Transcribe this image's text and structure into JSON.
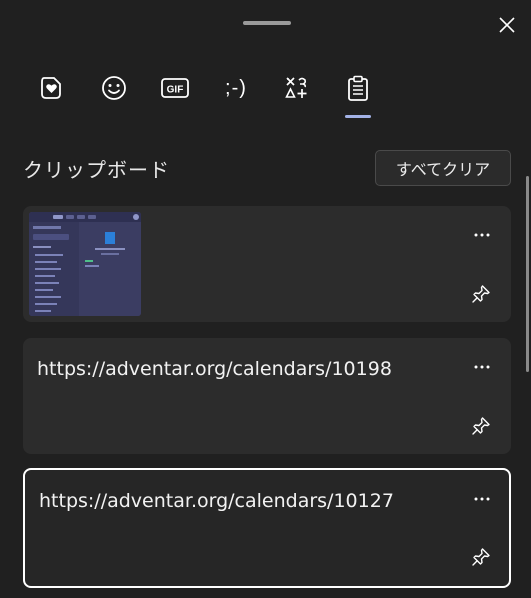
{
  "tabs": [
    {
      "icon": "heart-sticker-icon"
    },
    {
      "icon": "emoji-icon"
    },
    {
      "icon": "gif-icon",
      "label": "GIF"
    },
    {
      "icon": "kaomoji-icon",
      "label": ";-)"
    },
    {
      "icon": "symbols-icon"
    },
    {
      "icon": "clipboard-icon",
      "selected": true
    }
  ],
  "clipboard": {
    "title": "クリップボード",
    "clear_all_label": "すべてクリア",
    "items": [
      {
        "type": "image"
      },
      {
        "type": "text",
        "text": "https://adventar.org/calendars/10198"
      },
      {
        "type": "text",
        "text": "https://adventar.org/calendars/10127",
        "selected": true
      }
    ]
  },
  "colors": {
    "background": "#202020",
    "card": "#2c2c2c",
    "accent_underline": "#a3b2e6"
  }
}
